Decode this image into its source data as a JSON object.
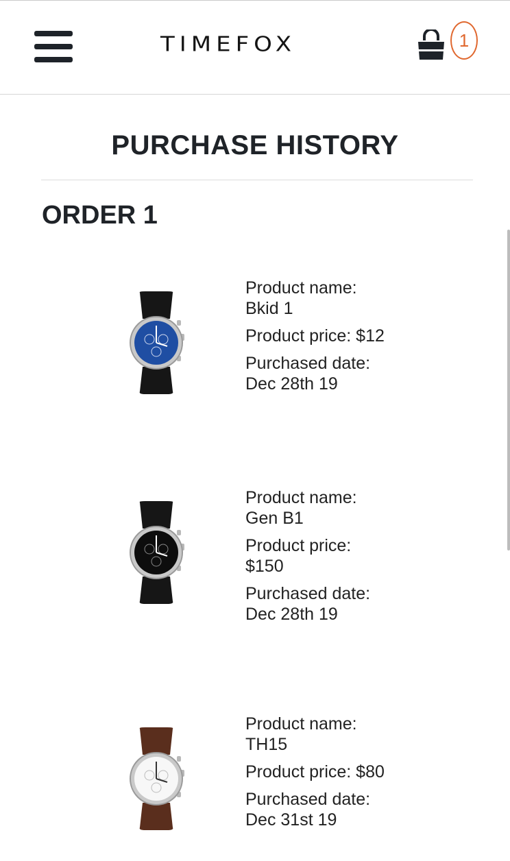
{
  "header": {
    "brand": "TIMEFOX",
    "cart_count": "1"
  },
  "page_title": "PURCHASE HISTORY",
  "order_title": "ORDER 1",
  "products": [
    {
      "name_label": "Product name:",
      "name": "Bkid 1",
      "price_label": "Product price: $12",
      "date_label": "Purchased date:",
      "date": "Dec 28th 19",
      "dial_color": "#1f4ea3",
      "strap_color": "#161616"
    },
    {
      "name_label": "Product name:",
      "name": "Gen B1",
      "price_label": "Product price:",
      "price": "$150",
      "date_label": "Purchased date:",
      "date": "Dec 28th 19",
      "dial_color": "#0d0d0d",
      "strap_color": "#161616"
    },
    {
      "name_label": "Product name:",
      "name": "TH15",
      "price_label": "Product price: $80",
      "date_label": "Purchased date:",
      "date": "Dec 31st 19",
      "dial_color": "#f7f7f7",
      "strap_color": "#5a2e1d"
    }
  ],
  "icons": {
    "menu": "hamburger-icon",
    "cart": "shopping-bag-icon"
  },
  "colors": {
    "accent": "#e0682f",
    "text": "#222222"
  }
}
